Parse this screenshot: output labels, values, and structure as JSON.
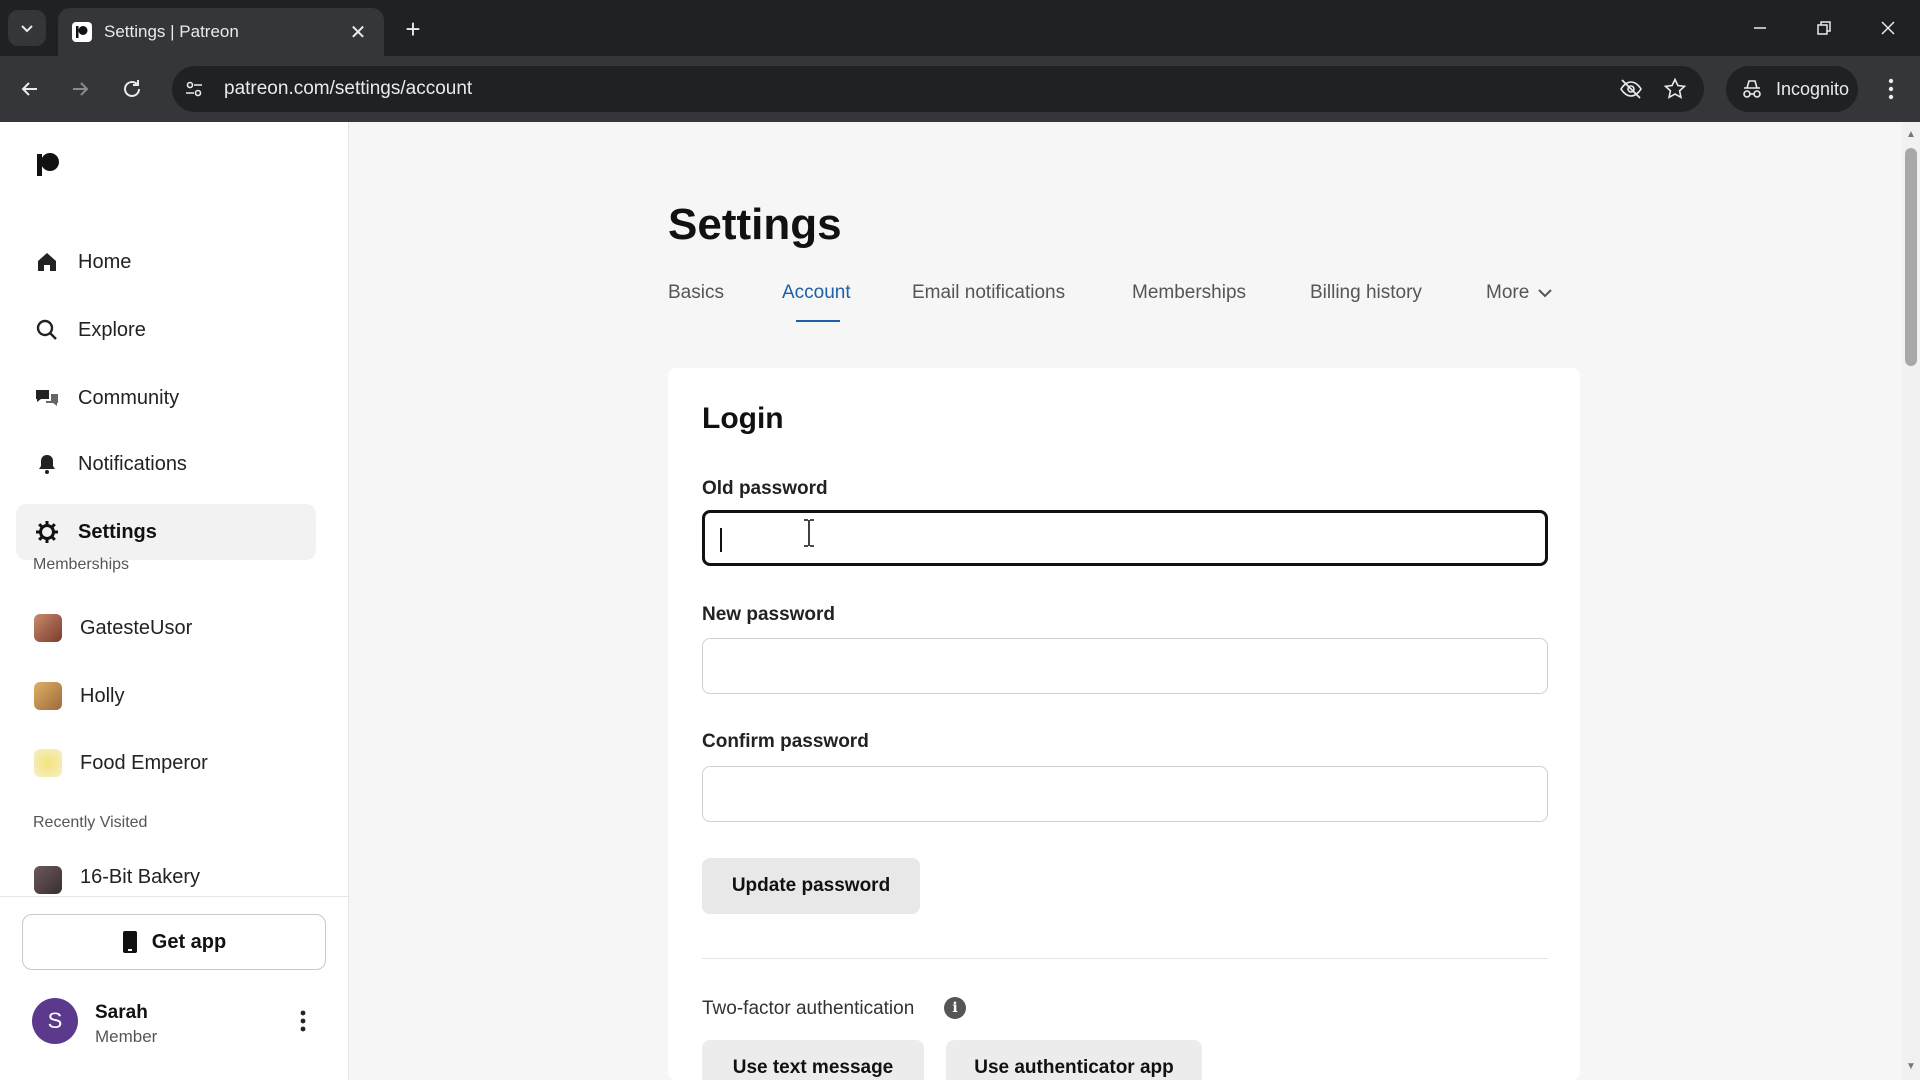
{
  "browser": {
    "tab_title": "Settings | Patreon",
    "url": "patreon.com/settings/account",
    "profile_label": "Incognito"
  },
  "sidebar": {
    "nav": [
      {
        "label": "Home",
        "icon": "home-icon"
      },
      {
        "label": "Explore",
        "icon": "search-icon"
      },
      {
        "label": "Community",
        "icon": "chat-icon"
      },
      {
        "label": "Notifications",
        "icon": "bell-icon"
      },
      {
        "label": "Settings",
        "icon": "gear-icon",
        "active": true
      }
    ],
    "memberships_heading": "Memberships",
    "memberships": [
      {
        "label": "GatesteUsor"
      },
      {
        "label": "Holly"
      },
      {
        "label": "Food Emperor"
      }
    ],
    "recent_heading": "Recently Visited",
    "recent": [
      {
        "label": "16-Bit Bakery"
      }
    ],
    "get_app_label": "Get app",
    "user": {
      "initial": "S",
      "name": "Sarah",
      "role": "Member"
    }
  },
  "main": {
    "title": "Settings",
    "tabs": [
      {
        "label": "Basics"
      },
      {
        "label": "Account",
        "active": true
      },
      {
        "label": "Email notifications"
      },
      {
        "label": "Memberships"
      },
      {
        "label": "Billing history"
      },
      {
        "label": "More"
      }
    ],
    "login": {
      "title": "Login",
      "old_password_label": "Old password",
      "new_password_label": "New password",
      "confirm_password_label": "Confirm password",
      "update_button": "Update password",
      "two_factor_label": "Two-factor authentication",
      "text_message_button": "Use text message",
      "authenticator_button": "Use authenticator app"
    }
  },
  "colors": {
    "accent": "#1d5fa8",
    "chrome_dark": "#202124",
    "chrome_mid": "#35363a"
  }
}
